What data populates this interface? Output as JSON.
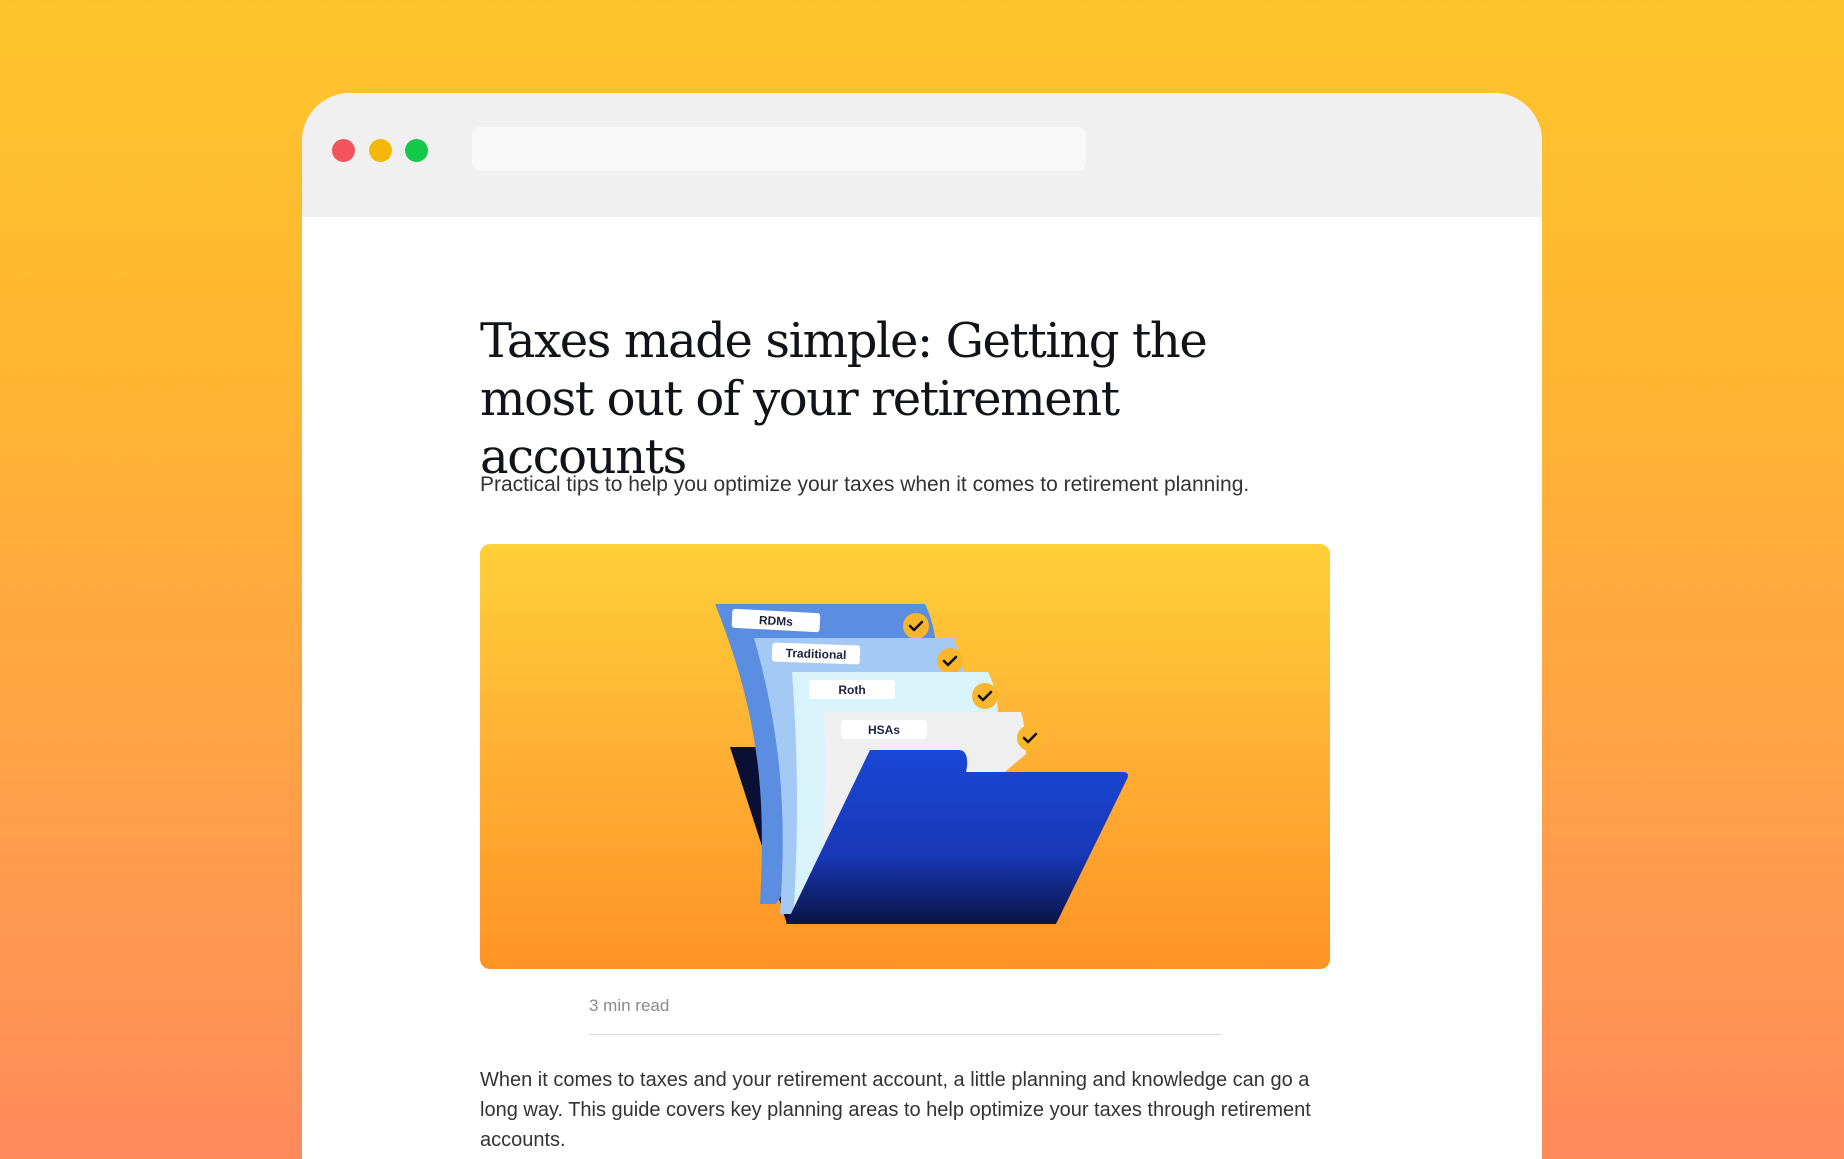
{
  "window": {
    "controls": {
      "close_color": "#F2545B",
      "minimize_color": "#F5B80A",
      "maximize_color": "#12C94A"
    },
    "url_bar": {
      "value": ""
    }
  },
  "article": {
    "title": "Taxes made simple: Getting the most out of your retirement accounts",
    "subtitle": "Practical tips to help you optimize your taxes when it comes to retirement planning.",
    "hero_tabs": [
      "RDMs",
      "Traditional",
      "Roth",
      "HSAs"
    ],
    "read_time": "3 min read",
    "intro": "When it comes to taxes and your retirement account, a little planning and knowledge can go a long way. This guide covers key planning areas to help optimize your taxes through retirement accounts."
  },
  "colors": {
    "background_top": "#FFC52B",
    "background_bottom": "#FF8A5C",
    "folder_blue": "#1A47D6",
    "folder_dark": "#0A1033",
    "check_badge": "#F9B52B"
  }
}
